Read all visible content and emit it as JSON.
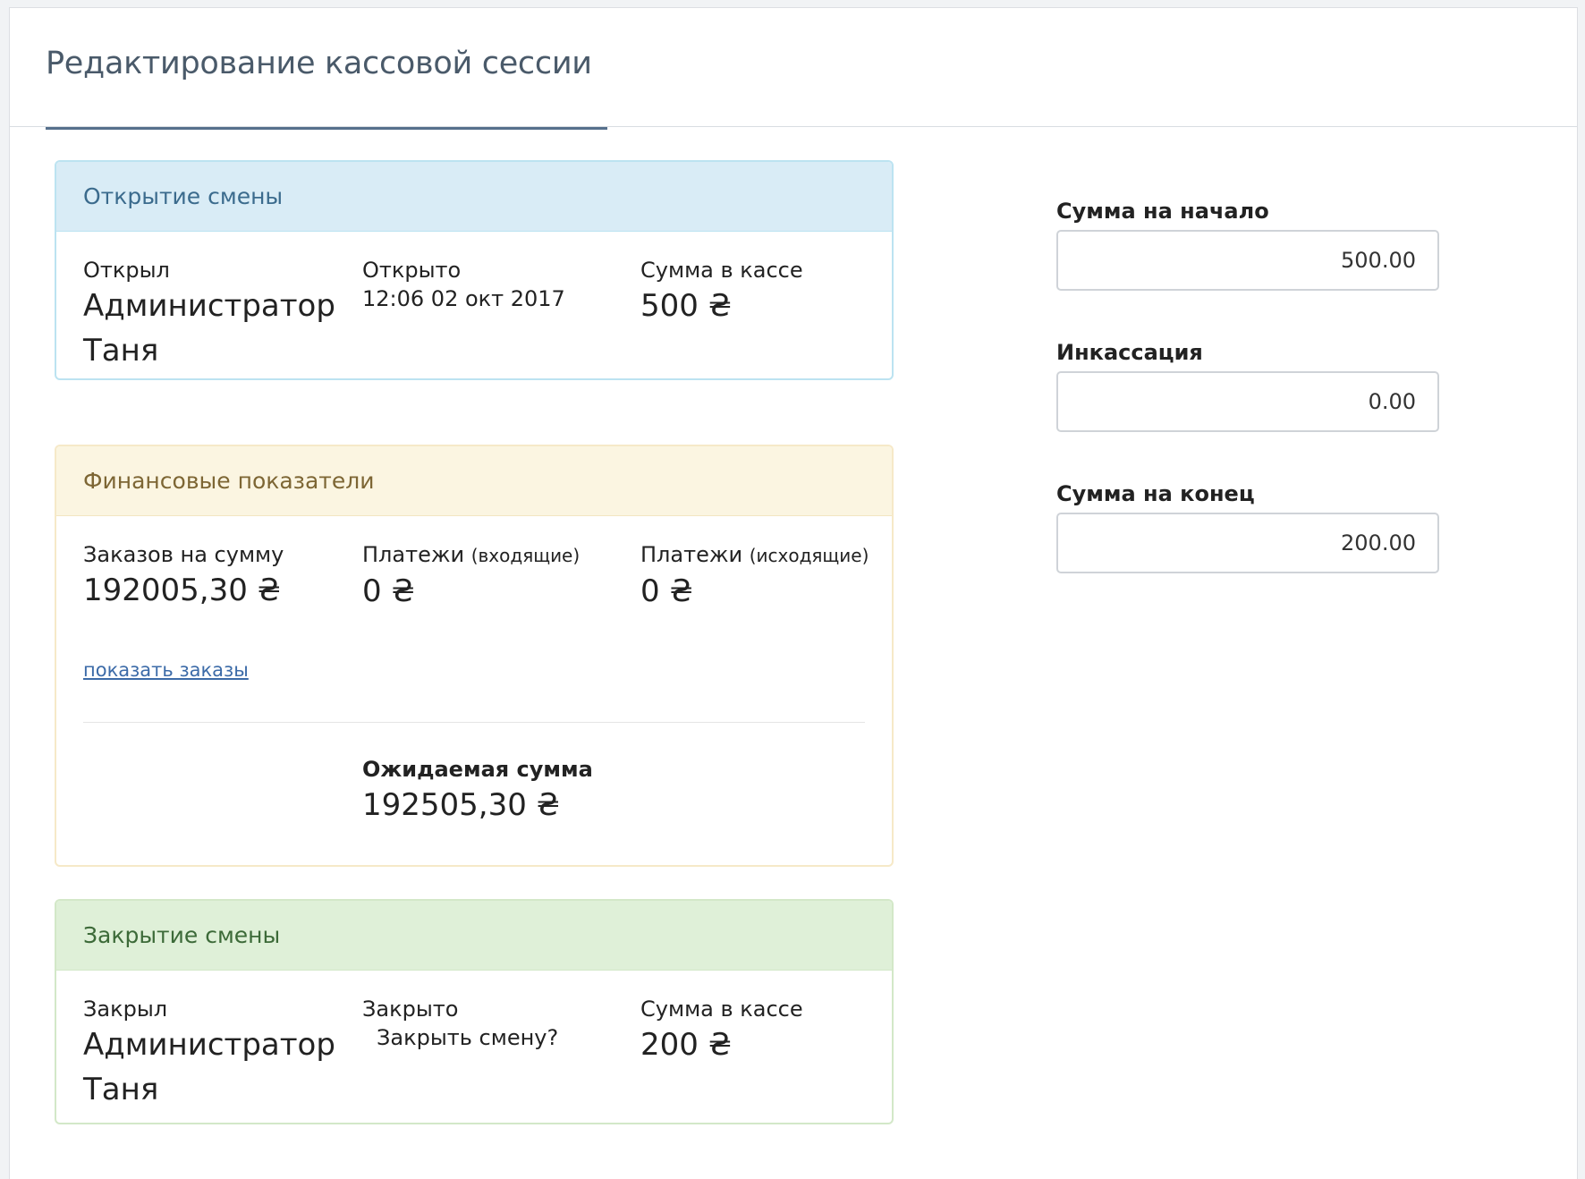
{
  "page": {
    "title": "Редактирование кассовой сессии"
  },
  "opening": {
    "heading": "Открытие смены",
    "opened_by_label": "Открыл",
    "opened_by": "Администратор Таня",
    "opened_at_label": "Открыто",
    "opened_at": "12:06 02 окт 2017",
    "cash_label": "Сумма в кассе",
    "cash_value": "500 ₴"
  },
  "financial": {
    "heading": "Финансовые показатели",
    "orders_label": "Заказов на сумму",
    "orders_value": "192005,30 ₴",
    "payments_in_label": "Платежи",
    "payments_in_note": "(входящие)",
    "payments_in_value": "0 ₴",
    "payments_out_label": "Платежи",
    "payments_out_note": "(исходящие)",
    "payments_out_value": "0 ₴",
    "show_orders_link": "показать заказы",
    "expected_label": "Ожидаемая сумма",
    "expected_value": "192505,30 ₴"
  },
  "closing": {
    "heading": "Закрытие смены",
    "closed_by_label": "Закрыл",
    "closed_by": "Администратор Таня",
    "closed_at_label": "Закрыто",
    "close_prompt": "Закрыть смену?",
    "cash_label": "Сумма в кассе",
    "cash_value": "200 ₴"
  },
  "form": {
    "start_sum_label": "Сумма на начало",
    "start_sum_value": "500.00",
    "collection_label": "Инкассация",
    "collection_value": "0.00",
    "end_sum_label": "Сумма на конец",
    "end_sum_value": "200.00"
  },
  "colors": {
    "info_heading_bg": "#d9ecf6",
    "warning_heading_bg": "#fbf5e1",
    "success_heading_bg": "#dff0d8",
    "link": "#3c6ba8"
  }
}
